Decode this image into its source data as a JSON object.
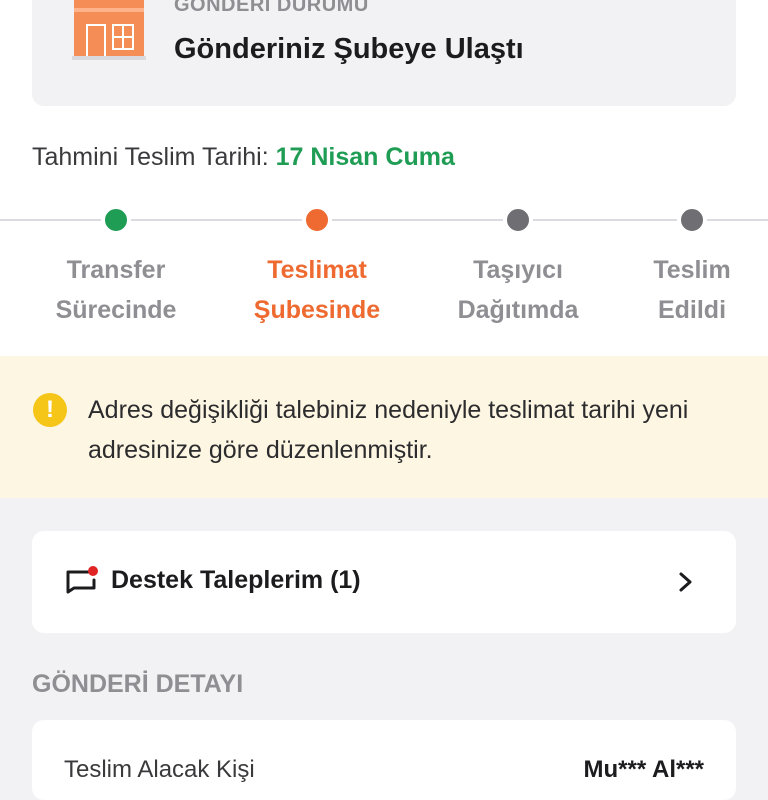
{
  "colors": {
    "done": "#1f9d55",
    "active": "#ee6a30",
    "pending": "#6e6e73",
    "warning": "#f5c518",
    "notice_bg": "#fdf6e3"
  },
  "status": {
    "eyebrow": "GÖNDERİ DURUMU",
    "title": "Gönderiniz Şubeye Ulaştı",
    "icon": "building-icon"
  },
  "eta": {
    "label": "Tahmini Teslim Tarihi: ",
    "value": "17 Nisan Cuma"
  },
  "steps": [
    {
      "line1": "Transfer",
      "line2": "Sürecinde",
      "state": "done"
    },
    {
      "line1": "Teslimat",
      "line2": "Şubesinde",
      "state": "active"
    },
    {
      "line1": "Taşıyıcı",
      "line2": "Dağıtımda",
      "state": "pending"
    },
    {
      "line1": "Teslim",
      "line2": "Edildi",
      "state": "pending"
    }
  ],
  "notice": {
    "icon": "warning-icon",
    "text": "Adres değişikliği talebiniz nedeniyle teslimat tarihi yeni adresinize göre düzenlenmiştir."
  },
  "support": {
    "label": "Destek Taleplerim (1)",
    "icon": "chat-icon",
    "chevron": "chevron-right-icon"
  },
  "details": {
    "section_title": "GÖNDERİ DETAYI",
    "rows": [
      {
        "label": "Teslim Alacak Kişi",
        "value": "Mu*** Al***"
      }
    ]
  }
}
